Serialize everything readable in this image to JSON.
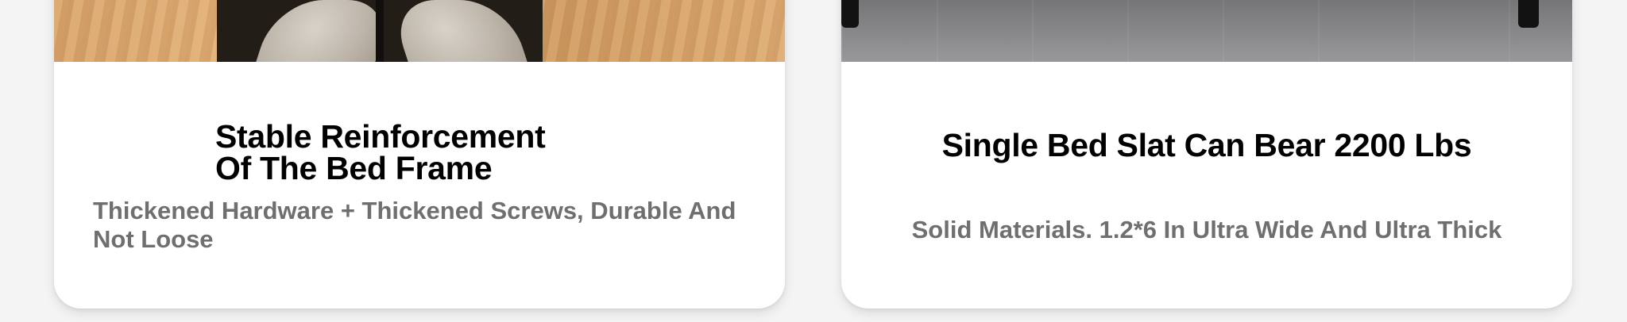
{
  "cards": [
    {
      "image_alt": "bed frame bracket on wooden floor",
      "title_line1": "Stable Reinforcement",
      "title_line2": "Of The Bed Frame",
      "description": "Thickened Hardware + Thickened Screws, Durable And Not Loose"
    },
    {
      "image_alt": "bed legs on grey stone floor",
      "title": "Single Bed Slat Can Bear 2200 Lbs",
      "description": "Solid Materials. 1.2*6 In Ultra Wide And Ultra Thick"
    }
  ],
  "colors": {
    "background": "#f4f4f4",
    "card": "#ffffff",
    "title": "#000000",
    "description": "#6f6f6f"
  }
}
